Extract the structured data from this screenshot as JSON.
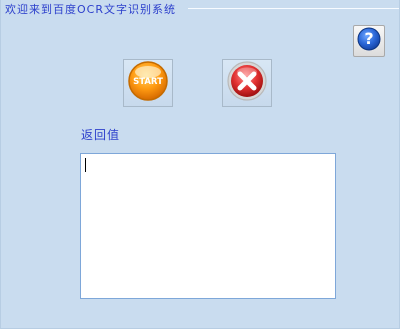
{
  "window": {
    "title": "欢迎来到百度OCR文字识别系统"
  },
  "toolbar": {
    "help_icon": "help-question-icon",
    "start_label": "START",
    "start_icon": "start-orb-icon",
    "close_icon": "close-x-icon"
  },
  "main": {
    "return_label": "返回值",
    "result_value": ""
  },
  "colors": {
    "background": "#c9dcef",
    "title_text": "#2c3fcc",
    "accent_orange": "#f28b00",
    "accent_red": "#c51616",
    "help_blue": "#1d59c7"
  }
}
